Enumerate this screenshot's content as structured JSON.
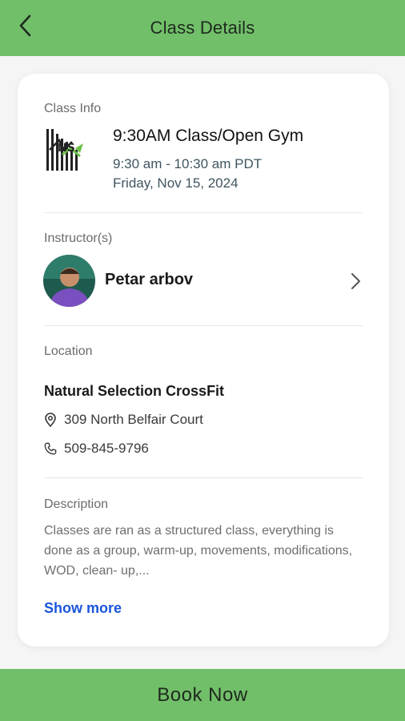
{
  "header": {
    "title": "Class Details"
  },
  "class_info": {
    "label": "Class Info",
    "title": "9:30AM Class/Open Gym",
    "time": "9:30 am - 10:30 am PDT",
    "date": "Friday, Nov 15, 2024",
    "logo_text": "NS"
  },
  "instructor": {
    "label": "Instructor(s)",
    "name": "Petar arbov"
  },
  "location": {
    "label": "Location",
    "name": "Natural Selection CrossFit",
    "address": "309 North Belfair Court",
    "phone": "509-845-9796"
  },
  "description": {
    "label": "Description",
    "text": "Classes are ran as a structured class, everything is done as a group, warm-up, movements, modifications, WOD, clean- up,...",
    "show_more": "Show more"
  },
  "book_button": {
    "label": "Book Now"
  },
  "colors": {
    "accent_green": "#72bf6a",
    "link_blue": "#1a56db"
  }
}
